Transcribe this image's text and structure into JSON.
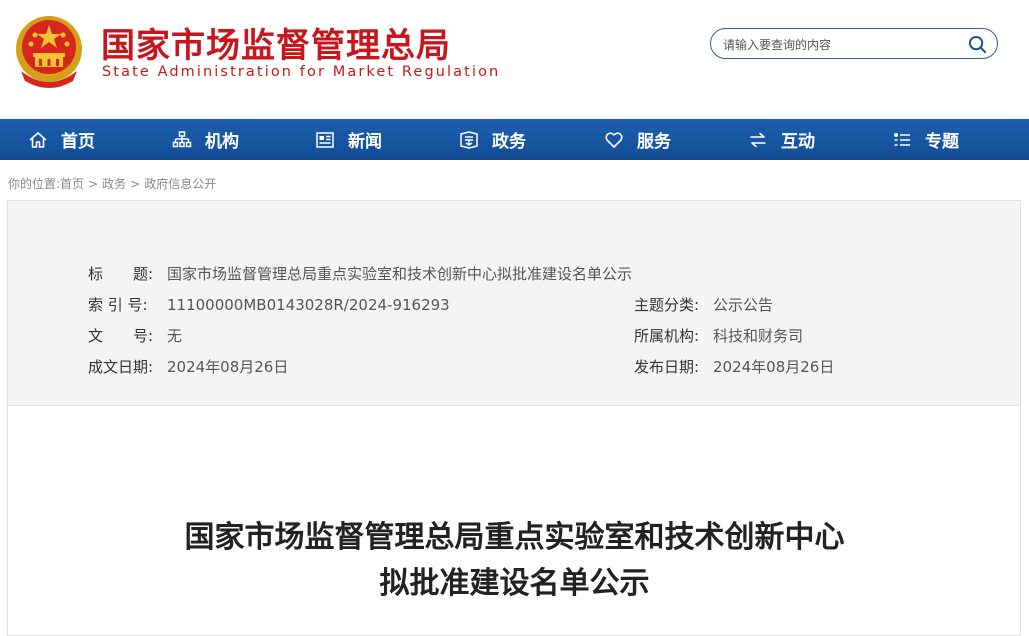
{
  "header": {
    "title": "国家市场监督管理总局",
    "subtitle": "State Administration for Market Regulation",
    "brand_color": "#c8161d"
  },
  "search": {
    "placeholder": "请输入要查询的内容",
    "icon": "search-icon"
  },
  "nav": {
    "items": [
      {
        "label": "首页",
        "icon": "home-icon"
      },
      {
        "label": "机构",
        "icon": "org-icon"
      },
      {
        "label": "新闻",
        "icon": "news-icon"
      },
      {
        "label": "政务",
        "icon": "affairs-icon"
      },
      {
        "label": "服务",
        "icon": "heart-icon"
      },
      {
        "label": "互动",
        "icon": "exchange-icon"
      },
      {
        "label": "专题",
        "icon": "topic-icon"
      }
    ],
    "bg_color": "#1a5aa6"
  },
  "breadcrumb": {
    "prefix": "你的位置:",
    "items": [
      "首页",
      "政务",
      "政府信息公开"
    ],
    "separator": ">"
  },
  "info": {
    "title_label": "标　　题:",
    "title_value": "国家市场监督管理总局重点实验室和技术创新中心拟批准建设名单公示",
    "index_label": "索 引 号:",
    "index_value": "11100000MB0143028R/2024-916293",
    "topic_label": "主题分类:",
    "topic_value": "公示公告",
    "doc_no_label": "文　　号:",
    "doc_no_value": "无",
    "org_label": "所属机构:",
    "org_value": "科技和财务司",
    "created_label": "成文日期:",
    "created_value": "2024年08月26日",
    "published_label": "发布日期:",
    "published_value": "2024年08月26日"
  },
  "document": {
    "title_line1": "国家市场监督管理总局重点实验室和技术创新中心",
    "title_line2": "拟批准建设名单公示"
  }
}
